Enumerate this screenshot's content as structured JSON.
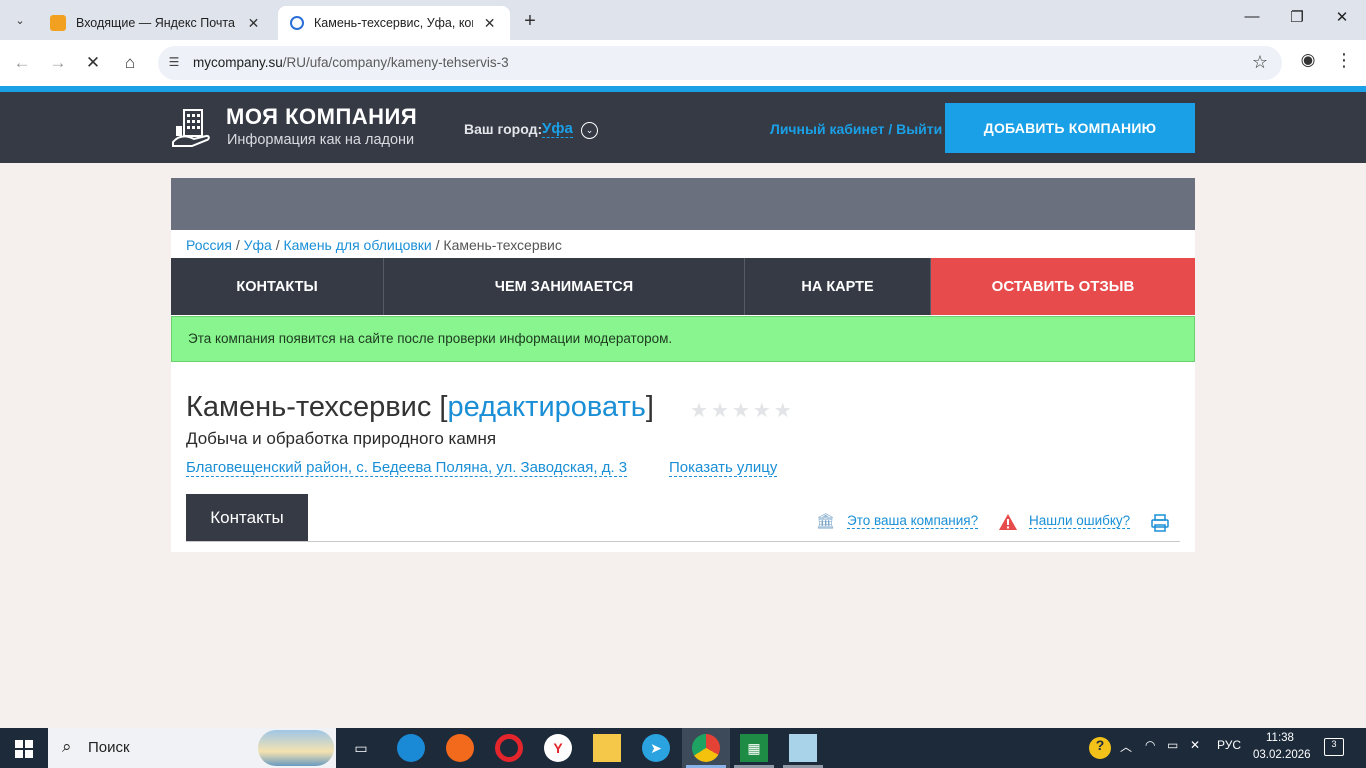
{
  "browser": {
    "tabs": [
      {
        "title": "Входящие — Яндекс Почта",
        "active": false
      },
      {
        "title": "Камень-техсервис, Уфа, конта",
        "active": true
      }
    ],
    "url_host": "mycompany.su",
    "url_path": "/RU/ufa/company/kameny-tehservis-3",
    "icons": {
      "tab_menu": "chevron-down-icon",
      "new_tab": "plus-icon",
      "back": "arrow-left-icon",
      "forward": "arrow-right-icon",
      "stop": "close-icon",
      "home": "home-icon",
      "site_info": "tune-icon",
      "bookmark": "star-icon",
      "profile": "profile-icon",
      "menu": "kebab-icon"
    }
  },
  "site": {
    "logo_title": "МОЯ КОМПАНИЯ",
    "logo_subtitle": "Информация как на ладони",
    "city_label": "Ваш город:",
    "city_value": "Уфа",
    "account_link": "Личный кабинет",
    "account_sep": " / ",
    "logout_link": "Выйти",
    "add_company_button": "ДОБАВИТЬ КОМПАНИЮ",
    "accent_color": "#1aa0e6",
    "header_color": "#353a45",
    "review_color": "#e84b4b"
  },
  "breadcrumbs": [
    "Россия",
    "Уфа",
    "Камень для облицовки",
    "Камень-техсервис"
  ],
  "nav_tabs": [
    "КОНТАКТЫ",
    "ЧЕМ ЗАНИМАЕТСЯ",
    "НА КАРТЕ",
    "ОСТАВИТЬ ОТЗЫВ"
  ],
  "notice": "Эта компания появится на сайте после проверки информации модератором.",
  "company": {
    "name": "Камень-техсервис",
    "bracket_open": " [",
    "edit_link": "редактировать",
    "bracket_close": "]",
    "rating_stars": 0,
    "rating_max": 5,
    "activity": "Добыча и обработка природного камня",
    "address": "Благовещенский район, с. Бедеева Поляна, ул. Заводская, д. 3",
    "show_street": "Показать улицу"
  },
  "section": {
    "tab": "Контакты",
    "own_company_link": "Это ваша компания?",
    "report_error_link": "Нашли ошибку?"
  },
  "taskbar": {
    "search_label": "Поиск",
    "language": "РУС",
    "time": "11:38",
    "date": "03.02.2026",
    "notifications": "3"
  }
}
